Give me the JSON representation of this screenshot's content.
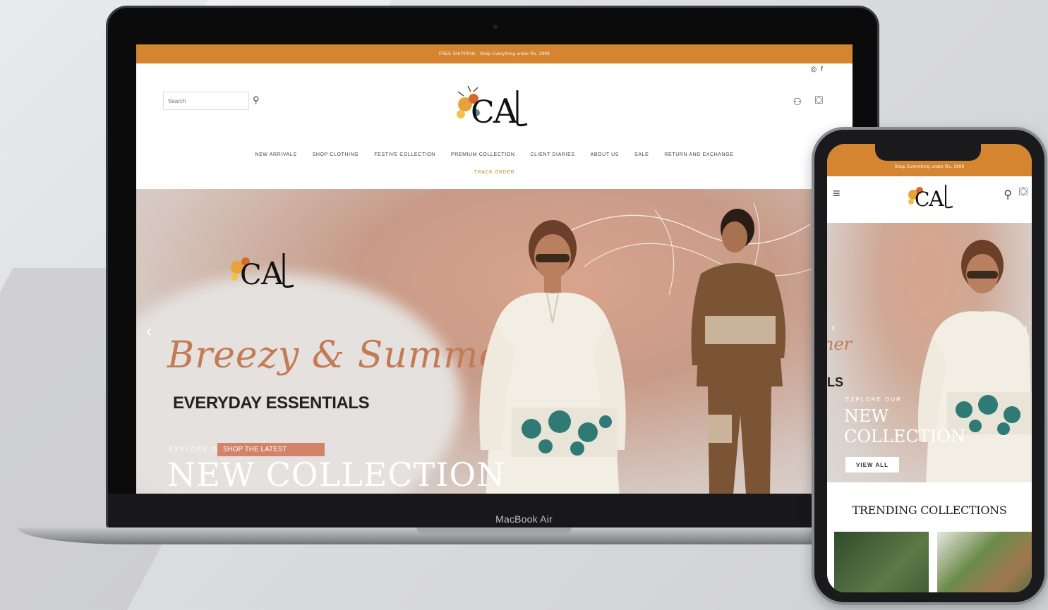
{
  "laptop": {
    "brand": "MacBook Air",
    "announcement": "FREE SHIPPING · Shop Everything under Rs. 2999",
    "search_placeholder": "Search",
    "nav": [
      "NEW ARRIVALS",
      "SHOP CLOTHING",
      "FESTIVE COLLECTION",
      "PREMIUM COLLECTION",
      "CLIENT DIARIES",
      "ABOUT US",
      "SALE",
      "RETURN AND EXCHANGE"
    ],
    "nav_extra": "TRACK ORDER",
    "hero": {
      "script_text": "Breezy & Summer",
      "headline": "EVERYDAY ESSENTIALS",
      "explore": "EXPLORE OUR",
      "cta": "SHOP THE LATEST",
      "collection": "NEW COLLECTION"
    }
  },
  "phone": {
    "announcement": "Shop Everything under Rs. 2999",
    "hero": {
      "script_text": "ner",
      "cut_headline": "LS",
      "explore": "EXPLORE OUR",
      "collection_line1": "NEW",
      "collection_line2": "COLLECTION",
      "cta": "VIEW ALL"
    },
    "section_title": "TRENDING COLLECTIONS"
  },
  "colors": {
    "accent": "#d5842f",
    "script": "#c47a55"
  }
}
